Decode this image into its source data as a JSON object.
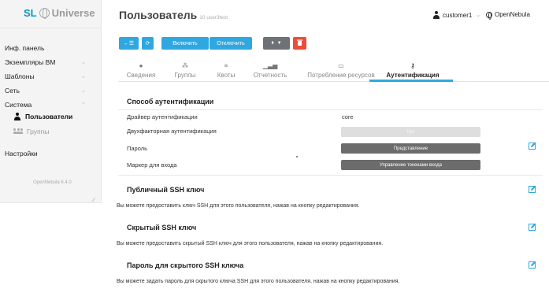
{
  "app": {
    "logo_prefix": "SL",
    "logo_name": "Universe",
    "version": "OpenNebula 6.4.0"
  },
  "sidebar": {
    "items": [
      {
        "label": "Инф. панель"
      },
      {
        "label": "Экземпляры ВМ"
      },
      {
        "label": "Шаблоны"
      },
      {
        "label": "Сеть"
      },
      {
        "label": "Система"
      },
      {
        "label": "Пользователи"
      },
      {
        "label": "Группы"
      },
      {
        "label": "Настройки"
      }
    ]
  },
  "header": {
    "title": "Пользователь",
    "subtitle": "10 user3test",
    "user": "customer1",
    "zone": "OpenNebula"
  },
  "toolbar": {
    "enable_label": "Включить",
    "disable_label": "Отключить"
  },
  "tabs": [
    {
      "label": "Сведения",
      "icon": "info-icon"
    },
    {
      "label": "Группы",
      "icon": "users-icon"
    },
    {
      "label": "Квоты",
      "icon": "align-icon"
    },
    {
      "label": "Отчетность",
      "icon": "bar-chart-icon"
    },
    {
      "label": "Потребление ресурсов",
      "icon": "server-icon"
    },
    {
      "label": "Аутентификация",
      "icon": "key-icon",
      "active": true
    }
  ],
  "auth": {
    "title": "Способ аутентификации",
    "driver_label": "Драйвер аутентификации",
    "driver_value": "core",
    "twofactor_label": "Двухфакторная аутентификация",
    "twofactor_button": "Нет",
    "password_label": "Пароль",
    "password_button": "Представление",
    "token_label": "Маркер для входа",
    "token_button": "Управление токенами входа"
  },
  "public_ssh": {
    "title": "Публичный SSH ключ",
    "description": "Вы можете предоставить ключ SSH для этого пользователя, нажав на кнопку редактирования."
  },
  "private_ssh": {
    "title": "Скрытый SSH ключ",
    "description": "Вы можете предоставить скрытый SSH ключ для этого пользователя, нажав на кнопку редактирования."
  },
  "private_ssh_pass": {
    "title": "Пароль для скрытого SSH ключа",
    "description": "Вы можете задать пароль для скрытого ключа SSH для этого пользователя, нажав на кнопку редактирования."
  },
  "colors": {
    "accent": "#2fa7e0",
    "danger": "#ea4d38",
    "neutral": "#6e7175"
  }
}
